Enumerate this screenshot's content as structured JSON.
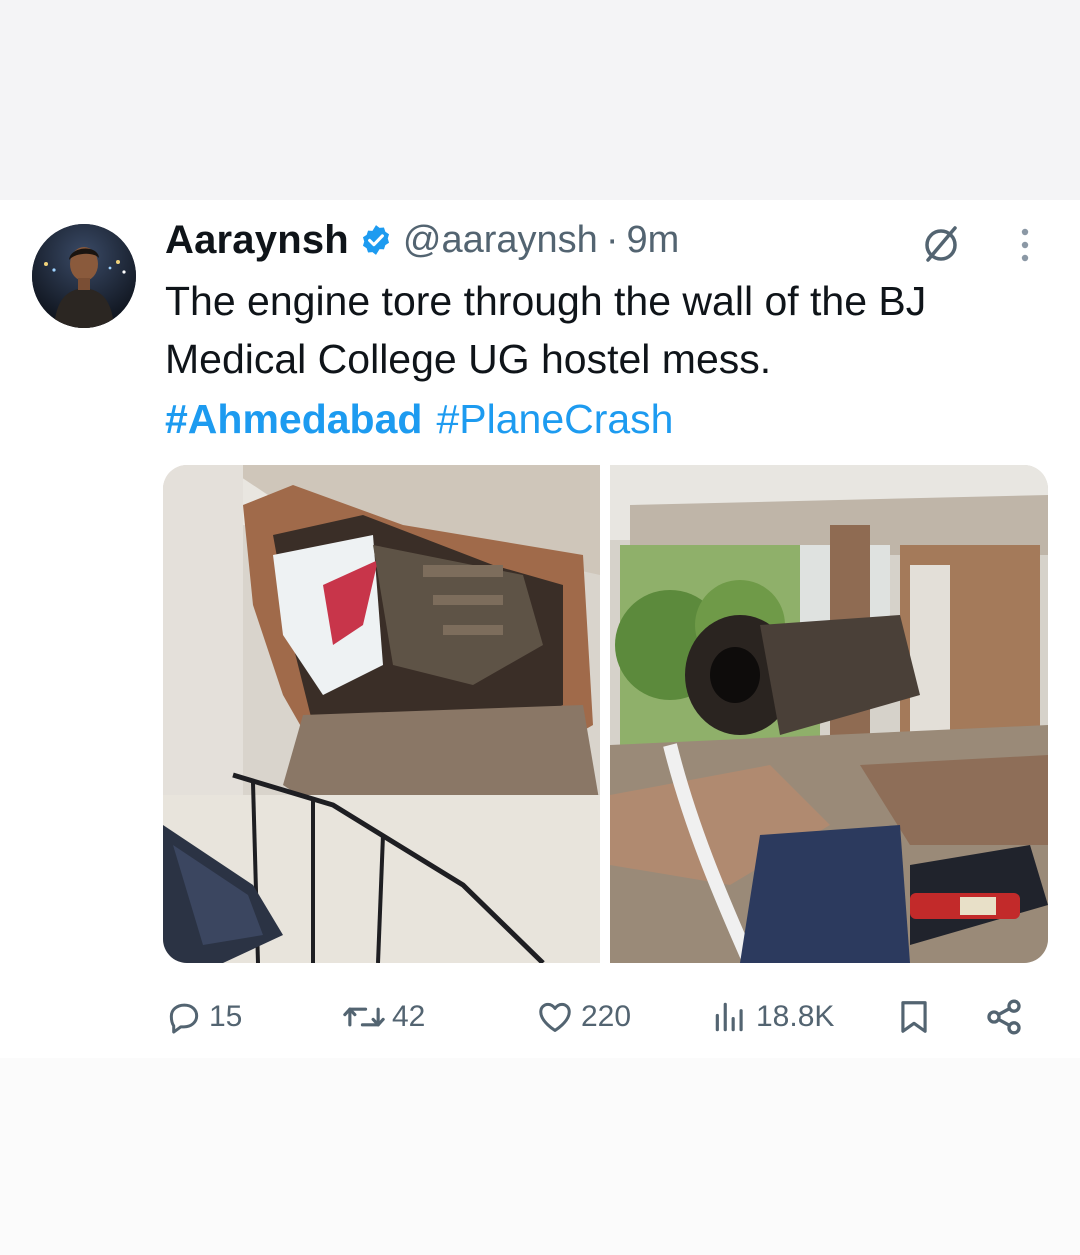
{
  "tweet": {
    "display_name": "Aaraynsh",
    "handle": "@aaraynsh",
    "separator": "·",
    "time": "9m",
    "text_line1": "The engine tore through the wall of the BJ",
    "text_line2": "Medical College UG hostel mess.",
    "hashtags": [
      "#Ahmedabad",
      "#PlaneCrash"
    ],
    "verified": true
  },
  "actions": {
    "replies": "15",
    "reposts": "42",
    "likes": "220",
    "views": "18.8K"
  },
  "icons": [
    "verified-badge-icon",
    "grok-icon",
    "more-icon",
    "reply-icon",
    "repost-icon",
    "like-icon",
    "views-icon",
    "bookmark-icon",
    "share-icon"
  ],
  "colors": {
    "link": "#1d9bf0",
    "text": "#0f1419",
    "secondary": "#536471"
  }
}
